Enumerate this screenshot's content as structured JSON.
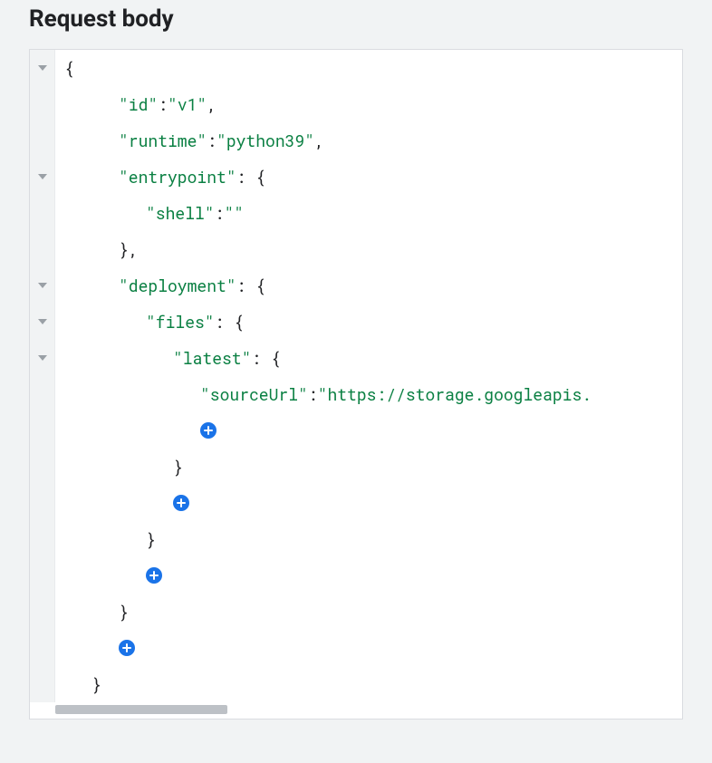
{
  "heading": "Request body",
  "code": {
    "lines": [
      {
        "toggle": true,
        "indent": 0,
        "tokens": [
          {
            "t": "punc",
            "v": "{"
          }
        ]
      },
      {
        "toggle": false,
        "indent": 2,
        "tokens": [
          {
            "t": "key",
            "v": "\"id\""
          },
          {
            "t": "punc",
            "v": ": "
          },
          {
            "t": "str",
            "v": "\"v1\""
          },
          {
            "t": "punc",
            "v": ","
          }
        ]
      },
      {
        "toggle": false,
        "indent": 2,
        "tokens": [
          {
            "t": "key",
            "v": "\"runtime\""
          },
          {
            "t": "punc",
            "v": ": "
          },
          {
            "t": "str",
            "v": "\"python39\""
          },
          {
            "t": "punc",
            "v": ","
          }
        ]
      },
      {
        "toggle": true,
        "indent": 2,
        "tokens": [
          {
            "t": "key",
            "v": "\"entrypoint\""
          },
          {
            "t": "punc",
            "v": ": {"
          }
        ]
      },
      {
        "toggle": false,
        "indent": 3,
        "tokens": [
          {
            "t": "key",
            "v": "\"shell\""
          },
          {
            "t": "punc",
            "v": ": "
          },
          {
            "t": "str",
            "v": "\"\""
          }
        ]
      },
      {
        "toggle": false,
        "indent": 2,
        "tokens": [
          {
            "t": "punc",
            "v": "},"
          }
        ]
      },
      {
        "toggle": true,
        "indent": 2,
        "tokens": [
          {
            "t": "key",
            "v": "\"deployment\""
          },
          {
            "t": "punc",
            "v": ": {"
          }
        ]
      },
      {
        "toggle": true,
        "indent": 3,
        "tokens": [
          {
            "t": "key",
            "v": "\"files\""
          },
          {
            "t": "punc",
            "v": ": {"
          }
        ]
      },
      {
        "toggle": true,
        "indent": 4,
        "tokens": [
          {
            "t": "key",
            "v": "\"latest\""
          },
          {
            "t": "punc",
            "v": ": {"
          }
        ]
      },
      {
        "toggle": false,
        "indent": 5,
        "tokens": [
          {
            "t": "key",
            "v": "\"sourceUrl\""
          },
          {
            "t": "punc",
            "v": ": "
          },
          {
            "t": "str",
            "v": "\"https://storage.googleapis."
          }
        ]
      },
      {
        "toggle": false,
        "indent": 5,
        "add": true
      },
      {
        "toggle": false,
        "indent": 4,
        "tokens": [
          {
            "t": "punc",
            "v": "}"
          }
        ]
      },
      {
        "toggle": false,
        "indent": 4,
        "add": true
      },
      {
        "toggle": false,
        "indent": 3,
        "tokens": [
          {
            "t": "punc",
            "v": "}"
          }
        ]
      },
      {
        "toggle": false,
        "indent": 3,
        "add": true
      },
      {
        "toggle": false,
        "indent": 2,
        "tokens": [
          {
            "t": "punc",
            "v": "}"
          }
        ]
      },
      {
        "toggle": false,
        "indent": 2,
        "add": true
      },
      {
        "toggle": false,
        "indent": 1,
        "tokens": [
          {
            "t": "punc",
            "v": "}"
          }
        ]
      }
    ]
  }
}
